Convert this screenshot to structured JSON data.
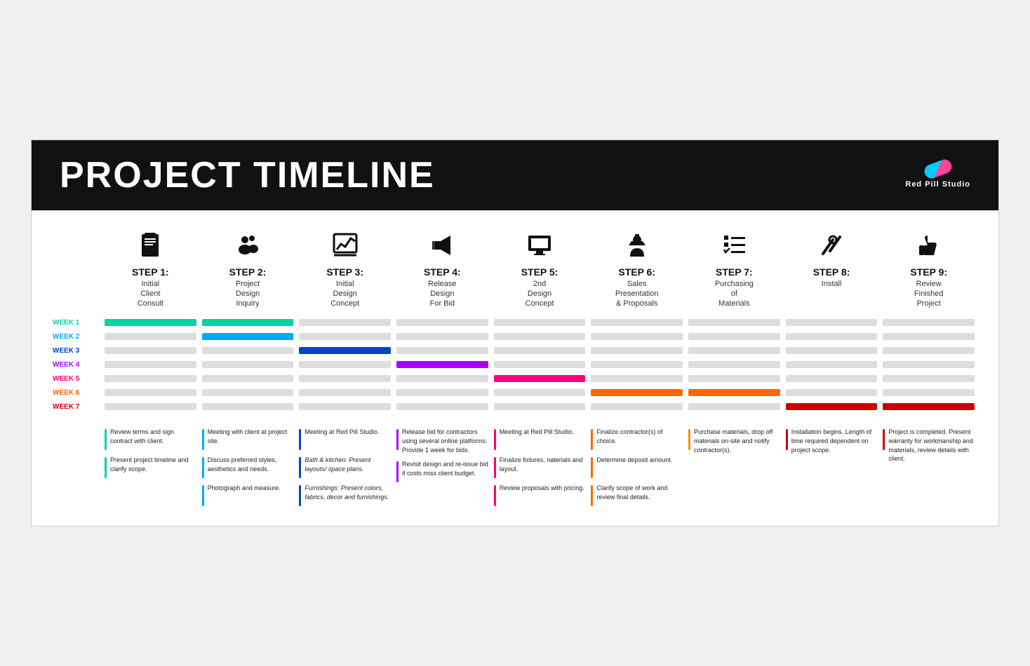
{
  "header": {
    "title": "PROJECT TIMELINE",
    "logo_text": "Red Pill Studio"
  },
  "steps": [
    {
      "number": "STEP 1:",
      "name": "Initial\nClient\nConsult",
      "icon": "📋"
    },
    {
      "number": "STEP 2:",
      "name": "Project\nDesign\nInquiry",
      "icon": "👥"
    },
    {
      "number": "STEP 3:",
      "name": "Initial\nDesign\nConcept",
      "icon": "📈"
    },
    {
      "number": "STEP 4:",
      "name": "Release\nDesign\nFor Bid",
      "icon": "📢"
    },
    {
      "number": "STEP 5:",
      "name": "2nd\nDesign\nConcept",
      "icon": "🖥"
    },
    {
      "number": "STEP 6:",
      "name": "Sales\nPresentation\n& Proposals",
      "icon": "👷"
    },
    {
      "number": "STEP 7:",
      "name": "Purchasing\nof\nMaterials",
      "icon": "📋"
    },
    {
      "number": "STEP 8:",
      "name": "Install",
      "icon": "🔧"
    },
    {
      "number": "STEP 9:",
      "name": "Review\nFinished\nProject",
      "icon": "👍"
    }
  ],
  "weeks": [
    "WEEK 1",
    "WEEK 2",
    "WEEK 3",
    "WEEK 4",
    "WEEK 5",
    "WEEK 6",
    "WEEK 7"
  ],
  "week_classes": [
    "w1",
    "w2",
    "w3",
    "w4",
    "w5",
    "w6",
    "w7"
  ],
  "gantt": [
    [
      "teal",
      "teal",
      "inactive",
      "inactive",
      "inactive",
      "inactive",
      "inactive",
      "inactive",
      "inactive"
    ],
    [
      "inactive",
      "blue",
      "inactive",
      "inactive",
      "inactive",
      "inactive",
      "inactive",
      "inactive",
      "inactive"
    ],
    [
      "inactive",
      "inactive",
      "darkblue",
      "inactive",
      "inactive",
      "inactive",
      "inactive",
      "inactive",
      "inactive"
    ],
    [
      "inactive",
      "inactive",
      "inactive",
      "purple",
      "inactive",
      "inactive",
      "inactive",
      "inactive",
      "inactive"
    ],
    [
      "inactive",
      "inactive",
      "inactive",
      "inactive",
      "pink",
      "inactive",
      "inactive",
      "inactive",
      "inactive"
    ],
    [
      "inactive",
      "inactive",
      "inactive",
      "inactive",
      "inactive",
      "orange",
      "orange",
      "inactive",
      "inactive"
    ],
    [
      "inactive",
      "inactive",
      "inactive",
      "inactive",
      "inactive",
      "inactive",
      "inactive",
      "red",
      "red"
    ]
  ],
  "descriptions": [
    {
      "color": "#00d4a0",
      "items": [
        "Review terms and sign contract with client.",
        "Present project timeline and clarify scope."
      ]
    },
    {
      "color": "#00aaff",
      "items": [
        "Meeting with client at project site.",
        "Discuss preferred styles, aesthetics and needs.",
        "Photograph and measure."
      ]
    },
    {
      "color": "#0044cc",
      "items": [
        "Meeting at Red Pill Studio.",
        "Bath & kitchen: Present layouts/ space plans.",
        "Furnishings: Present colors, fabrics, decor and furnishings."
      ]
    },
    {
      "color": "#aa00ff",
      "items": [
        "Release bid for contractors using several online platforms. Provide 1 week for bids.",
        "Revisit design and re-issue bid if costs miss client budget."
      ]
    },
    {
      "color": "#ff0077",
      "items": [
        "Meeting at Red Pill Studio.",
        "Finalize fixtures, naterials and layout.",
        "Review proposals with pricing."
      ]
    },
    {
      "color": "#ff6600",
      "items": [
        "Finalize contractor(s) of choice.",
        "Determine deposit amount.",
        "Clarify scope of work and review final details."
      ]
    },
    {
      "color": "#ff8800",
      "items": [
        "Purchase materials, drop off materials on-site and notify contractor(s)."
      ]
    },
    {
      "color": "#cc0000",
      "items": [
        "Installation begins. Length of time required dependent on project scope."
      ]
    },
    {
      "color": "#cc0000",
      "items": [
        "Project is completed. Present warranty for workmanship and materials, review details with client."
      ]
    }
  ]
}
